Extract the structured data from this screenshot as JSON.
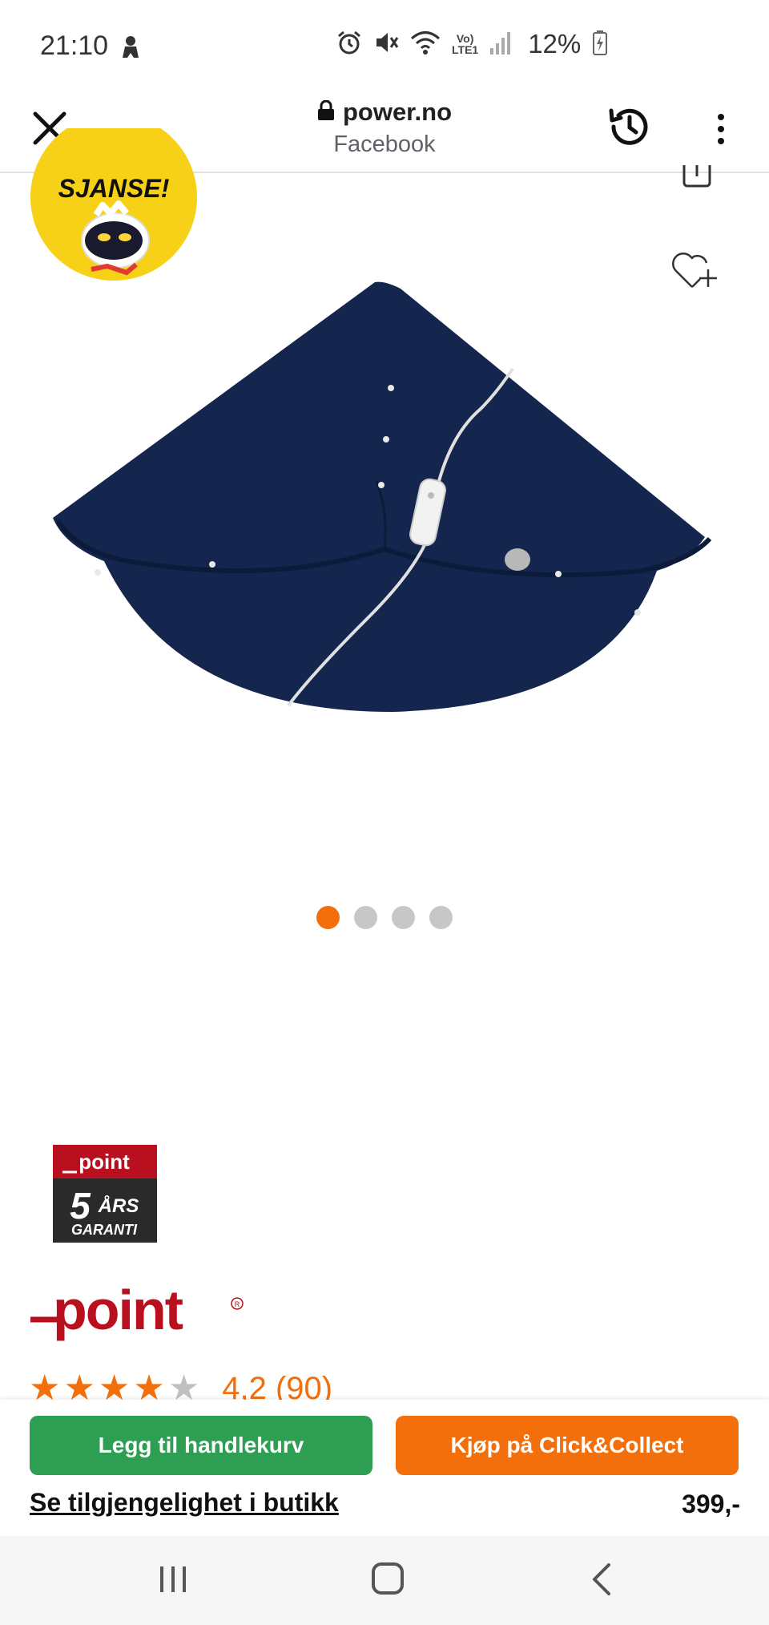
{
  "status_bar": {
    "time": "21:10",
    "battery": "12%",
    "network_top": "Vo)",
    "network_bottom": "LTE1",
    "icons": [
      "person-icon",
      "alarm-icon",
      "mute-icon",
      "wifi-icon",
      "signal-icon",
      "battery-charging-icon"
    ]
  },
  "browser": {
    "domain": "power.no",
    "source": "Facebook",
    "icons": [
      "close-icon",
      "lock-icon",
      "history-icon",
      "more-vert-icon"
    ]
  },
  "badge": {
    "text": "SJANSE!",
    "color": "#f7d117"
  },
  "product": {
    "image_description_icon": "heated-shawl-image",
    "carousel": {
      "total": 4,
      "active_index": 0
    }
  },
  "warranty": {
    "brand": "point",
    "years": "5",
    "line1": "ÅRS",
    "line2": "GARANTI"
  },
  "brand": {
    "name": "point",
    "color": "#b8101f"
  },
  "rating": {
    "stars": 4.2,
    "text": "4,2 (90)"
  },
  "actions": {
    "add_to_cart": "Legg til handlekurv",
    "click_collect": "Kjøp på Click&Collect",
    "availability": "Se tilgjengelighet i butikk",
    "price": "399,-"
  },
  "colors": {
    "accent": "#f36f0c",
    "cart_green": "#2e9e52",
    "product_navy": "#14254d"
  },
  "nav_bar": {
    "icons": [
      "recent-apps-icon",
      "home-icon",
      "back-icon"
    ]
  }
}
